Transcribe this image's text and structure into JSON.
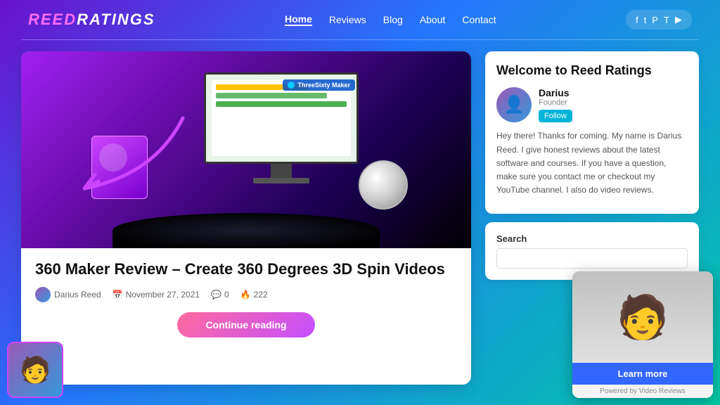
{
  "header": {
    "logo_text": "ReedRatings",
    "nav_items": [
      {
        "label": "Home",
        "active": true
      },
      {
        "label": "Reviews",
        "active": false
      },
      {
        "label": "Blog",
        "active": false
      },
      {
        "label": "About",
        "active": false
      },
      {
        "label": "Contact",
        "active": false
      }
    ],
    "social_icons": [
      "f",
      "t",
      "p",
      "t",
      "yt"
    ]
  },
  "article": {
    "title": "360 Maker Review – Create 360 Degrees 3D Spin Videos",
    "author": "Darius Reed",
    "date": "November 27, 2021",
    "comments": "0",
    "likes": "222",
    "continue_btn": "Continue reading"
  },
  "sidebar": {
    "welcome_title": "Welcome to Reed Ratings",
    "author_name": "Darius",
    "author_role": "Founder",
    "author_btn": "Follow",
    "description": "Hey there! Thanks for coming. My name is Darius Reed. I give honest reviews about the latest software and courses. If you have a question, make sure you contact me or checkout my YouTube channel. I also do video reviews.",
    "search_label": "Search",
    "search_placeholder": ""
  },
  "video_popup": {
    "learn_more": "Learn more",
    "powered_by": "Powered by Video Reviews"
  }
}
